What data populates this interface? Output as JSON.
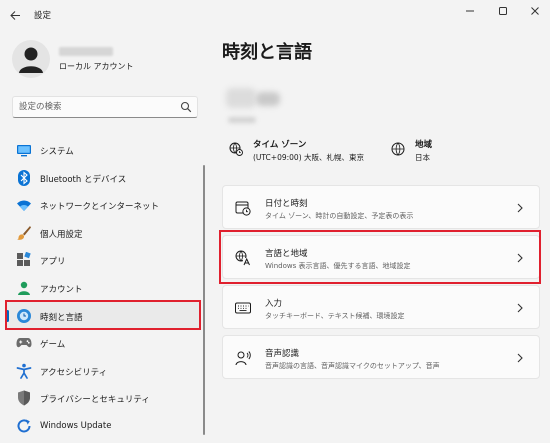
{
  "window": {
    "title": "設定",
    "controls": [
      "minimize-icon",
      "maximize-icon",
      "close-icon"
    ]
  },
  "profile": {
    "account_type": "ローカル アカウント"
  },
  "search": {
    "placeholder": "設定の検索"
  },
  "sidebar": {
    "items": [
      {
        "label": "システム",
        "icon": "system-icon"
      },
      {
        "label": "Bluetooth とデバイス",
        "icon": "bluetooth-icon"
      },
      {
        "label": "ネットワークとインターネット",
        "icon": "wifi-icon"
      },
      {
        "label": "個人用設定",
        "icon": "brush-icon"
      },
      {
        "label": "アプリ",
        "icon": "apps-icon"
      },
      {
        "label": "アカウント",
        "icon": "account-icon"
      },
      {
        "label": "時刻と言語",
        "icon": "time-language-icon",
        "active": true
      },
      {
        "label": "ゲーム",
        "icon": "gamepad-icon"
      },
      {
        "label": "アクセシビリティ",
        "icon": "accessibility-icon"
      },
      {
        "label": "プライバシーとセキュリティ",
        "icon": "shield-icon"
      },
      {
        "label": "Windows Update",
        "icon": "update-icon"
      }
    ]
  },
  "main": {
    "title": "時刻と言語",
    "timezone": {
      "title": "タイム ゾーン",
      "value": "(UTC+09:00) 大阪、札幌、東京"
    },
    "region": {
      "title": "地域",
      "value": "日本"
    },
    "cards": [
      {
        "title": "日付と時刻",
        "subtitle": "タイム ゾーン、時計の自動設定、予定表の表示",
        "icon": "calendar-clock-icon"
      },
      {
        "title": "言語と地域",
        "subtitle": "Windows 表示言語、優先する言語、地域設定",
        "icon": "language-icon",
        "highlighted": true
      },
      {
        "title": "入力",
        "subtitle": "タッチキーボード、テキスト候補、環境設定",
        "icon": "keyboard-icon"
      },
      {
        "title": "音声認識",
        "subtitle": "音声認識の言語、音声認識マイクのセットアップ、音声",
        "icon": "speech-icon"
      }
    ]
  },
  "colors": {
    "accent": "#0067c0",
    "highlight": "#e0202e",
    "background": "#f3f3f3",
    "card": "#fbfbfb"
  }
}
